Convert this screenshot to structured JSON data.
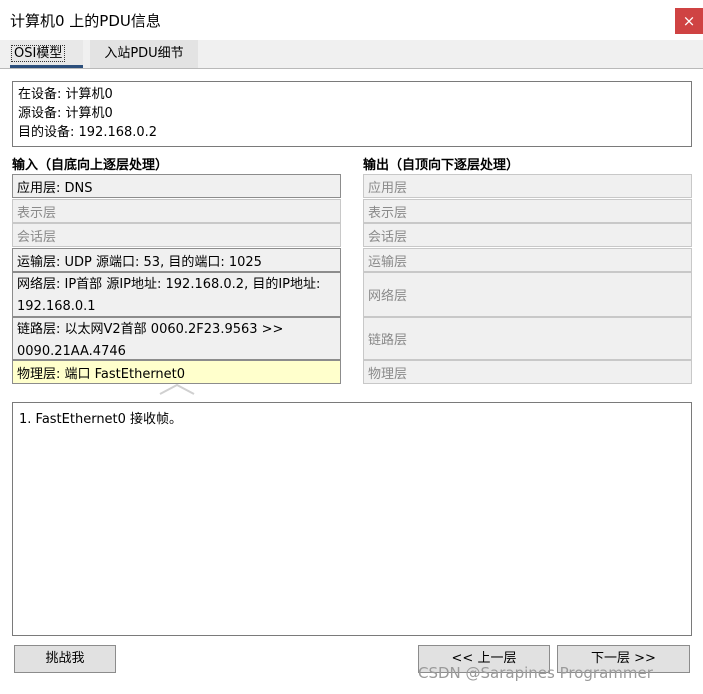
{
  "window": {
    "title": "计算机0 上的PDU信息",
    "close_label": "×"
  },
  "tabs": [
    {
      "label": "OSI模型",
      "active": true
    },
    {
      "label": "入站PDU细节",
      "active": false
    }
  ],
  "device_info": [
    "在设备: 计算机0",
    "源设备: 计算机0",
    "目的设备: 192.168.0.2"
  ],
  "in_layers": {
    "heading": "输入（自底向上逐层处理）",
    "items": [
      {
        "text": "应用层: DNS",
        "active": true
      },
      {
        "text": "表示层",
        "active": false
      },
      {
        "text": "会话层",
        "active": false
      },
      {
        "text": "运输层: UDP 源端口: 53, 目的端口: 1025",
        "active": true
      },
      {
        "text": "网络层: IP首部 源IP地址: 192.168.0.2, 目的IP地址: 192.168.0.1",
        "active": true
      },
      {
        "text": "链路层: 以太网V2首部 0060.2F23.9563 >> 0090.21AA.4746",
        "active": true
      },
      {
        "text": "物理层: 端口 FastEthernet0",
        "active": true,
        "highlighted": true
      }
    ]
  },
  "out_layers": {
    "heading": "输出（自顶向下逐层处理）",
    "items": [
      "应用层",
      "表示层",
      "会话层",
      "运输层",
      "网络层",
      "链路层",
      "物理层"
    ]
  },
  "messages": [
    "1. FastEthernet0 接收帧。"
  ],
  "buttons": {
    "challenge": "挑战我",
    "prev": "<< 上一层",
    "next": "下一层 >>"
  },
  "watermark": "CSDN @Sarapines Programmer",
  "colors": {
    "highlight": "#ffffcc",
    "close": "#cf4343",
    "tab_underline": "#2c4f7c"
  }
}
